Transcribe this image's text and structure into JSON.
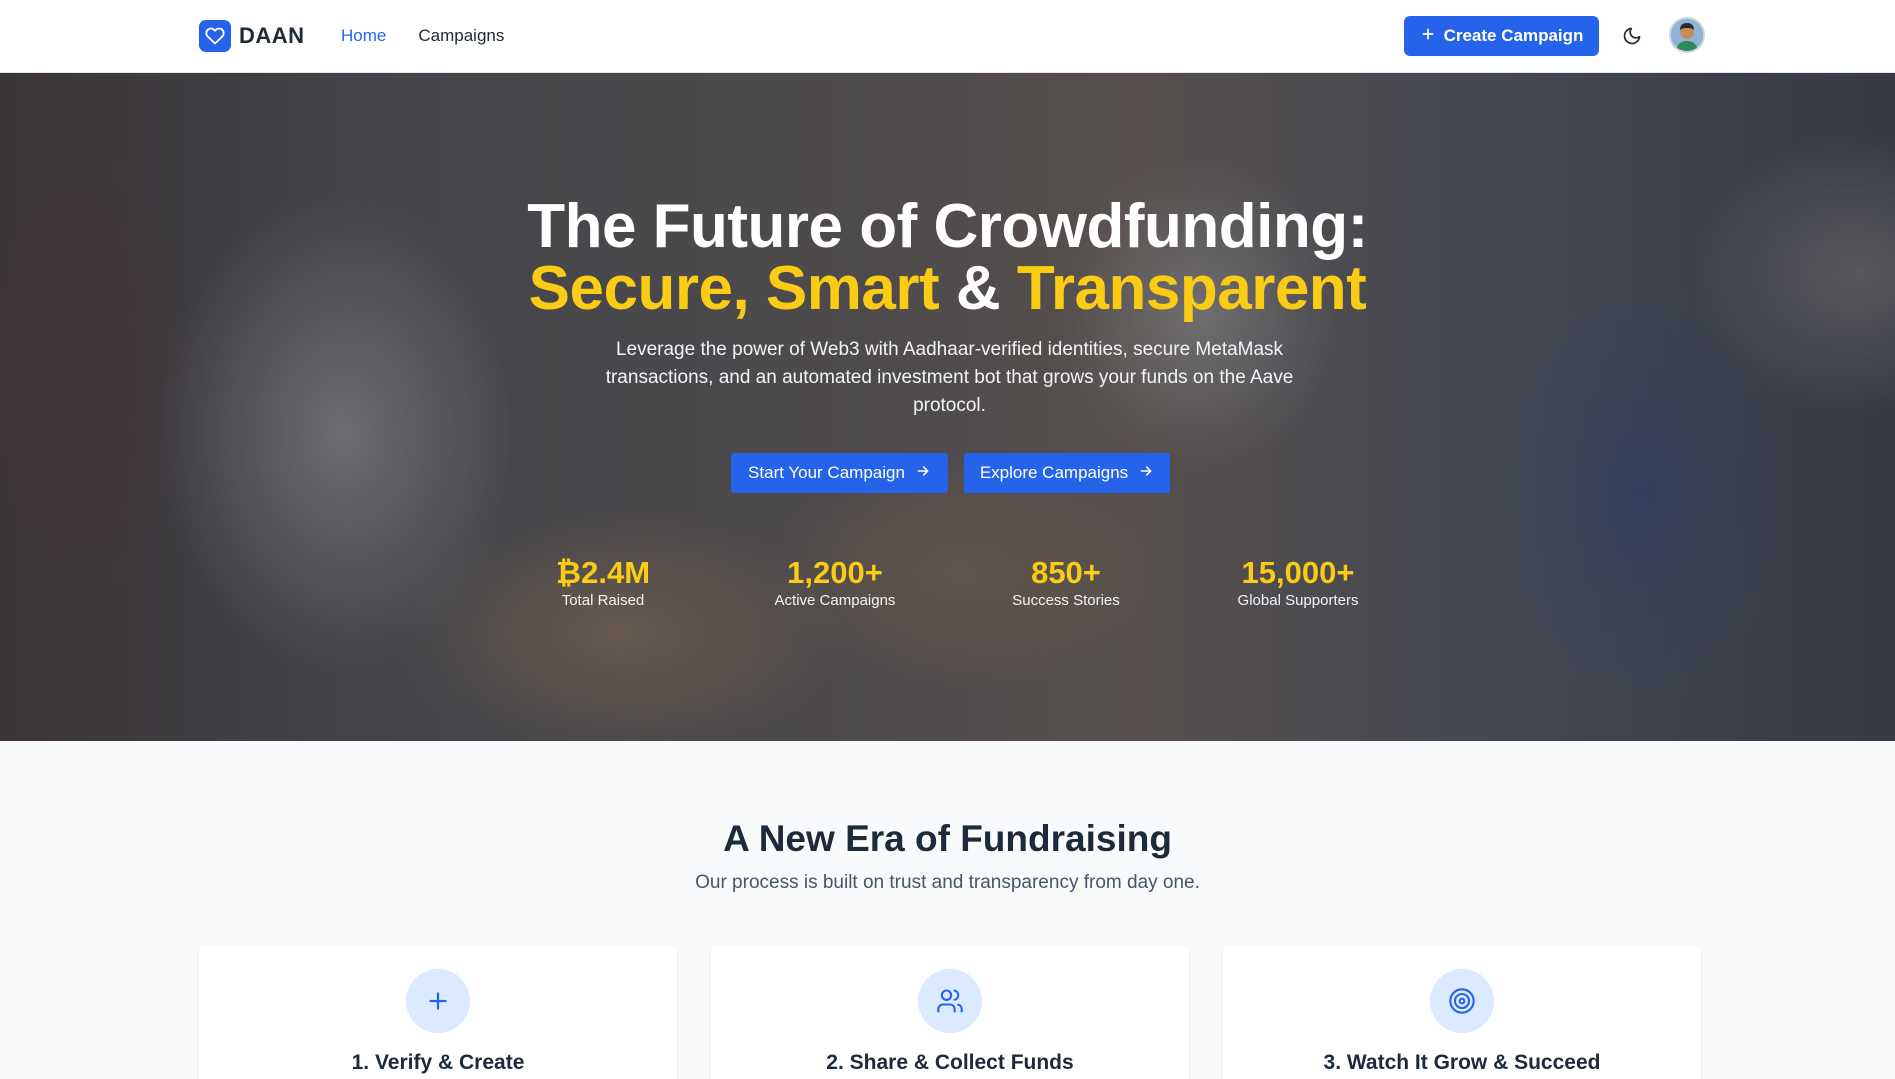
{
  "nav": {
    "brand": "DAAN",
    "links": [
      {
        "label": "Home",
        "active": true
      },
      {
        "label": "Campaigns",
        "active": false
      }
    ],
    "create_label": "Create Campaign"
  },
  "hero": {
    "title_line1": "The Future of Crowdfunding:",
    "title_secure": "Secure,",
    "title_smart": "Smart",
    "title_amp": "&",
    "title_transparent": "Transparent",
    "subtitle": "Leverage the power of Web3 with Aadhaar-verified identities, secure MetaMask transactions, and an automated investment bot that grows your funds on the Aave protocol.",
    "start_label": "Start Your Campaign",
    "explore_label": "Explore Campaigns",
    "stats": [
      {
        "value": "₿2.4M",
        "label": "Total Raised"
      },
      {
        "value": "1,200+",
        "label": "Active Campaigns"
      },
      {
        "value": "850+",
        "label": "Success Stories"
      },
      {
        "value": "15,000+",
        "label": "Global Supporters"
      }
    ]
  },
  "features": {
    "title": "A New Era of Fundraising",
    "subtitle": "Our process is built on trust and transparency from day one.",
    "cards": [
      {
        "title": "1. Verify & Create",
        "icon": "plus-icon"
      },
      {
        "title": "2. Share & Collect Funds",
        "icon": "users-icon"
      },
      {
        "title": "3. Watch It Grow & Succeed",
        "icon": "target-icon"
      }
    ]
  },
  "colors": {
    "primary": "#2563eb",
    "accent": "#facc15",
    "text_dark": "#1e293b"
  }
}
